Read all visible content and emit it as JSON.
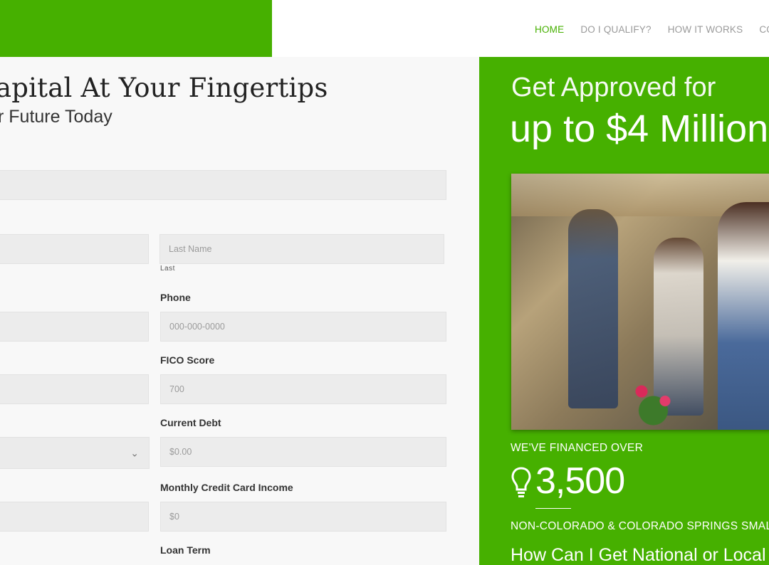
{
  "nav": {
    "items": [
      {
        "label": "HOME",
        "active": true
      },
      {
        "label": "DO I QUALIFY?",
        "active": false
      },
      {
        "label": "HOW IT WORKS",
        "active": false
      },
      {
        "label": "CONT",
        "active": false
      }
    ]
  },
  "hero": {
    "headline": "apital At Your Fingertips",
    "subheadline": "r Future Today"
  },
  "form": {
    "last_name_placeholder": "Last Name",
    "last_sublabel": "Last",
    "phone_label": "Phone",
    "phone_placeholder": "000-000-0000",
    "fico_label": "FICO Score",
    "fico_placeholder": "700",
    "debt_label": "Current Debt",
    "debt_placeholder": "$0.00",
    "cc_income_label": "Monthly Credit Card Income",
    "cc_income_placeholder": "$0",
    "loan_term_label": "Loan Term"
  },
  "promo": {
    "line1": "Get Approved for",
    "line2": "up to $4 Million",
    "financed_label": "WE'VE FINANCED OVER",
    "count": "3,500",
    "locations": "NON-COLORADO & COLORADO SPRINGS SMAL",
    "question": "How Can I Get National or Local C"
  },
  "colors": {
    "brand_green": "#46b000",
    "nav_inactive": "#9a9a9a",
    "field_bg": "#ececec"
  }
}
